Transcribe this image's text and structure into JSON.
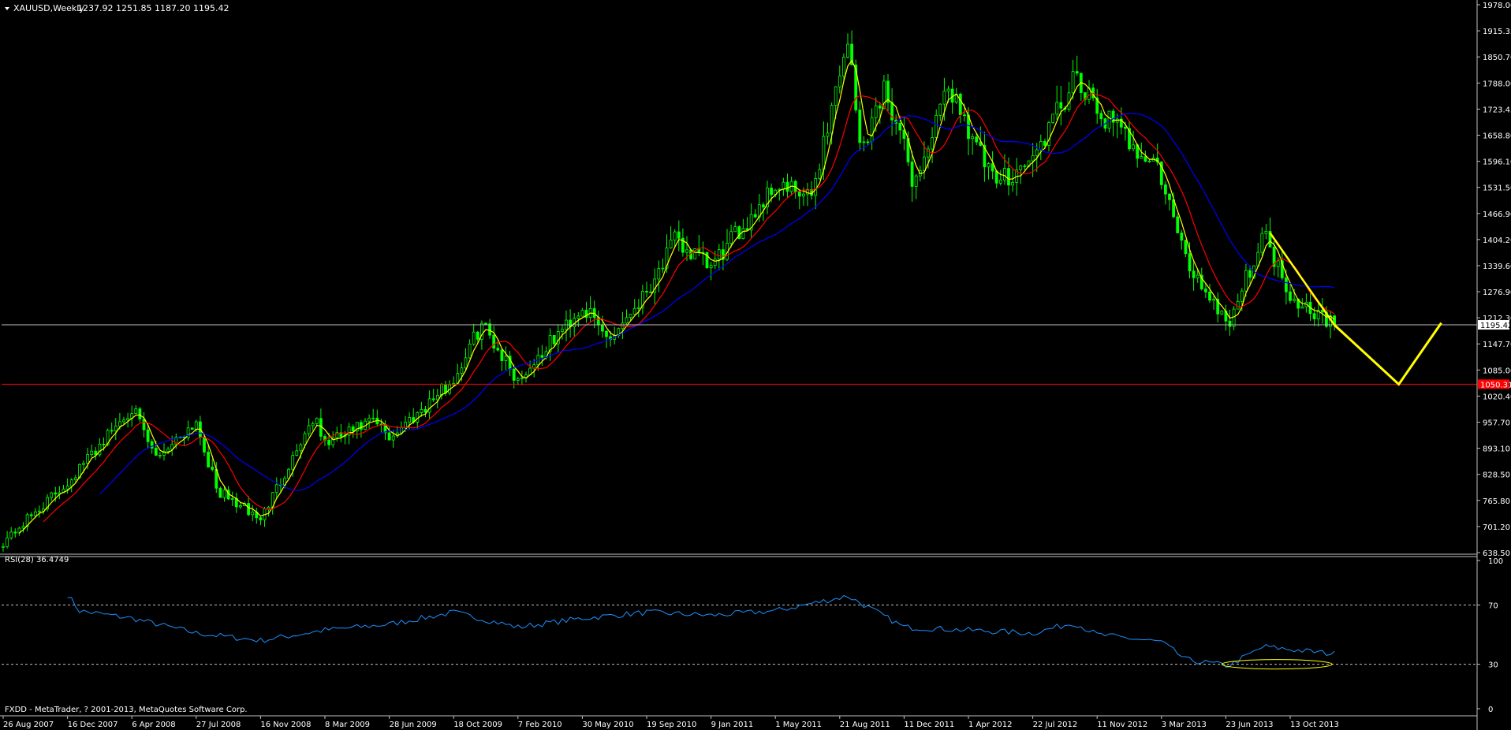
{
  "header": {
    "symbol_timeframe": "XAUUSD,Weekly",
    "ohlc": "1237.92 1251.85 1187.20 1195.42"
  },
  "footer": {
    "copyright": "FXDD - MetaTrader, ? 2001-2013, MetaQuotes Software Corp."
  },
  "colors": {
    "background": "#000000",
    "candle": "#00ff00",
    "ma_fast": "#ffff00",
    "ma_mid": "#ff0000",
    "ma_slow": "#0000ff",
    "rsi_line": "#1e90ff",
    "support_line": "#ff0000",
    "price_line": "#c0c0c0",
    "projection": "#ffff00",
    "annotation_ellipse": "#ffff00",
    "axis": "#c0c0c0",
    "label_support_bg": "#ff0000"
  },
  "chart_data": [
    {
      "type": "candlestick",
      "panel": "price",
      "ylim": [
        638.5,
        1978.0
      ],
      "price_ticks": [
        "1978.00",
        "1915.35",
        "1850.70",
        "1788.00",
        "1723.45",
        "1658.80",
        "1596.10",
        "1531.50",
        "1466.90",
        "1404.20",
        "1339.60",
        "1276.90",
        "1212.30",
        "1147.70",
        "1085.00",
        "1020.40",
        "957.70",
        "893.10",
        "828.50",
        "765.80",
        "701.20",
        "638.50"
      ],
      "date_ticks": [
        "26 Aug 2007",
        "16 Dec 2007",
        "6 Apr 2008",
        "27 Jul 2008",
        "16 Nov 2008",
        "8 Mar 2009",
        "28 Jun 2009",
        "18 Oct 2009",
        "7 Feb 2010",
        "30 May 2010",
        "19 Sep 2010",
        "9 Jan 2011",
        "1 May 2011",
        "21 Aug 2011",
        "11 Dec 2011",
        "1 Apr 2012",
        "22 Jul 2012",
        "11 Nov 2012",
        "3 Mar 2013",
        "23 Jun 2013",
        "13 Oct 2013"
      ],
      "current_price": {
        "value": 1195.42,
        "label": "1195.42"
      },
      "support_level": {
        "value": 1050.31,
        "label": "1050.31"
      },
      "price_path": [
        [
          "26 Aug 2007",
          665
        ],
        [
          "16 Dec 2007",
          810
        ],
        [
          "6 Apr 2008",
          995
        ],
        [
          "16 May 2008",
          870
        ],
        [
          "27 Jul 2008",
          960
        ],
        [
          "1 Sep 2008",
          790
        ],
        [
          "16 Nov 2008",
          720
        ],
        [
          "16 Feb 2009",
          970
        ],
        [
          "8 Mar 2009",
          905
        ],
        [
          "1 Jun 2009",
          960
        ],
        [
          "28 Jun 2009",
          920
        ],
        [
          "18 Oct 2009",
          1060
        ],
        [
          "6 Dec 2009",
          1200
        ],
        [
          "7 Feb 2010",
          1060
        ],
        [
          "30 May 2010",
          1240
        ],
        [
          "15 Jul 2010",
          1160
        ],
        [
          "19 Sep 2010",
          1280
        ],
        [
          "7 Nov 2010",
          1400
        ],
        [
          "9 Jan 2011",
          1335
        ],
        [
          "1 May 2011",
          1540
        ],
        [
          "1 Jul 2011",
          1500
        ],
        [
          "4 Sep 2011",
          1900
        ],
        [
          "26 Sep 2011",
          1620
        ],
        [
          "8 Nov 2011",
          1780
        ],
        [
          "29 Dec 2011",
          1540
        ],
        [
          "29 Feb 2012",
          1780
        ],
        [
          "15 May 2012",
          1540
        ],
        [
          "22 Jul 2012",
          1600
        ],
        [
          "2 Oct 2012",
          1790
        ],
        [
          "11 Nov 2012",
          1720
        ],
        [
          "25 Feb 2013",
          1580
        ],
        [
          "15 Apr 2013",
          1350
        ],
        [
          "28 Jun 2013",
          1200
        ],
        [
          "28 Aug 2013",
          1420
        ],
        [
          "13 Oct 2013",
          1270
        ],
        [
          "29 Dec 2013",
          1195
        ]
      ],
      "series": [
        {
          "color": "#ffff00",
          "smoothing": 4
        },
        {
          "color": "#ff0000",
          "smoothing": 10
        },
        {
          "color": "#0000ff",
          "smoothing": 24
        }
      ],
      "projection": [
        [
          "29 Dec 2013",
          1195
        ],
        [
          "20 Apr 2014",
          1050
        ],
        [
          "3 Jul 2014",
          1200
        ]
      ],
      "trendline": [
        [
          "8 Sep 2013",
          1420
        ],
        [
          "29 Dec 2013",
          1195
        ]
      ]
    },
    {
      "type": "line",
      "panel": "indicator",
      "title": "RSI(28) 36.4749",
      "ylim": [
        0,
        100
      ],
      "y_ticks": [
        "100",
        "70",
        "30",
        "0"
      ],
      "levels": [
        70,
        30
      ],
      "path": [
        [
          "16 Dec 2007",
          77
        ],
        [
          "6 Jan 2008",
          66
        ],
        [
          "6 Apr 2008",
          61
        ],
        [
          "27 Jul 2008",
          51
        ],
        [
          "16 Nov 2008",
          46
        ],
        [
          "8 Mar 2009",
          53
        ],
        [
          "28 Jun 2009",
          57
        ],
        [
          "18 Oct 2009",
          65
        ],
        [
          "7 Feb 2010",
          55
        ],
        [
          "30 May 2010",
          61
        ],
        [
          "19 Sep 2010",
          65
        ],
        [
          "9 Jan 2011",
          63
        ],
        [
          "1 May 2011",
          66
        ],
        [
          "4 Sep 2011",
          76
        ],
        [
          "11 Dec 2011",
          55
        ],
        [
          "1 Apr 2012",
          53
        ],
        [
          "22 Jul 2012",
          51
        ],
        [
          "2 Oct 2012",
          58
        ],
        [
          "11 Nov 2012",
          50
        ],
        [
          "3 Mar 2013",
          45
        ],
        [
          "15 Apr 2013",
          33
        ],
        [
          "28 Jun 2013",
          29
        ],
        [
          "28 Aug 2013",
          42
        ],
        [
          "13 Oct 2013",
          40
        ],
        [
          "29 Dec 2013",
          37
        ]
      ],
      "annotation_ellipse": {
        "center": [
          "20 Sep 2013",
          30
        ]
      }
    }
  ]
}
